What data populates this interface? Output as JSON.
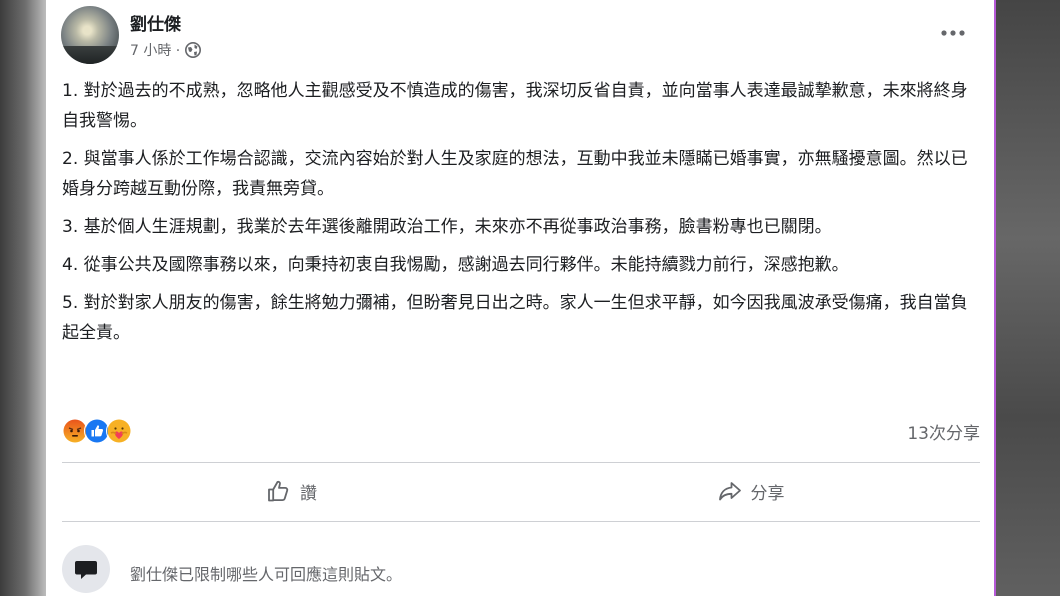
{
  "post": {
    "author": "劉仕傑",
    "time": "7 小時 ·",
    "paragraphs": [
      "1. 對於過去的不成熟，忽略他人主觀感受及不慎造成的傷害，我深切反省自責，並向當事人表達最誠摯歉意，未來將終身自我警惕。",
      "2. 與當事人係於工作場合認識，交流內容始於對人生及家庭的想法，互動中我並未隱瞞已婚事實，亦無騷擾意圖。然以已婚身分跨越互動份際，我責無旁貸。",
      "3. 基於個人生涯規劃，我業於去年選後離開政治工作，未來亦不再從事政治事務，臉書粉專也已關閉。",
      "4. 從事公共及國際事務以來，向秉持初衷自我惕勵，感謝過去同行夥伴。未能持續戮力前行，深感抱歉。",
      "5. 對於對家人朋友的傷害，餘生將勉力彌補，但盼奢見日出之時。家人一生但求平靜，如今因我風波承受傷痛，我自當負起全責。"
    ],
    "shares": "13次分享",
    "reactions": [
      "angry-reaction",
      "like-reaction",
      "care-reaction"
    ]
  },
  "actions": {
    "like_label": "讚",
    "share_label": "分享"
  },
  "footer": {
    "restricted_notice": "劉仕傑已限制哪些人可回應這則貼文。"
  },
  "colors": {
    "card_bg": "#ffffff",
    "text_primary": "#1c1e21",
    "text_secondary": "#65676b",
    "like_blue": "#1877f2",
    "angry_orange": "#f0701f",
    "border_purple": "#b65ad8"
  }
}
